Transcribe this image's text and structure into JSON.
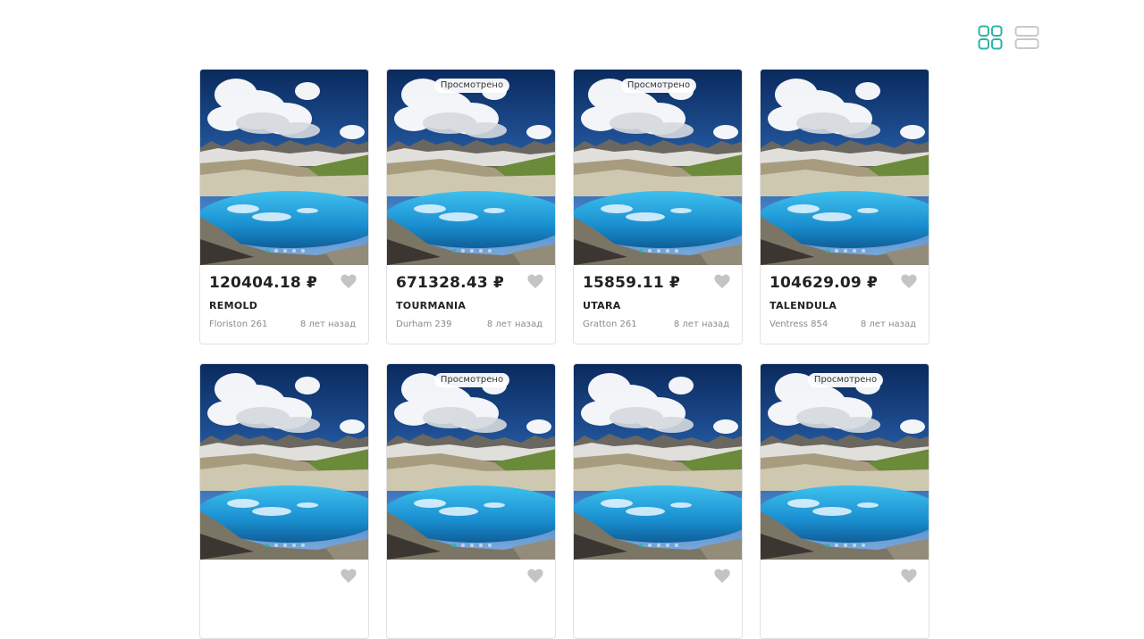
{
  "view_toggle": {
    "grid_icon": "grid-view-icon",
    "list_icon": "list-view-icon",
    "active": "grid"
  },
  "seen_label": "Просмотрено",
  "listings": [
    {
      "price": "120404.18 ₽",
      "name": "REMOLD",
      "address": "Floriston 261",
      "age": "8 лет назад",
      "seen": false
    },
    {
      "price": "671328.43 ₽",
      "name": "TOURMANIA",
      "address": "Durham 239",
      "age": "8 лет назад",
      "seen": true
    },
    {
      "price": "15859.11 ₽",
      "name": "UTARA",
      "address": "Gratton 261",
      "age": "8 лет назад",
      "seen": true
    },
    {
      "price": "104629.09 ₽",
      "name": "TALENDULA",
      "address": "Ventress 854",
      "age": "8 лет назад",
      "seen": false
    },
    {
      "seen": false
    },
    {
      "seen": true
    },
    {
      "seen": false
    },
    {
      "seen": true
    }
  ],
  "colors": {
    "accent": "#2fb2a8",
    "toggle_inactive": "#c8c8c8",
    "heart": "#c4c4c4"
  }
}
